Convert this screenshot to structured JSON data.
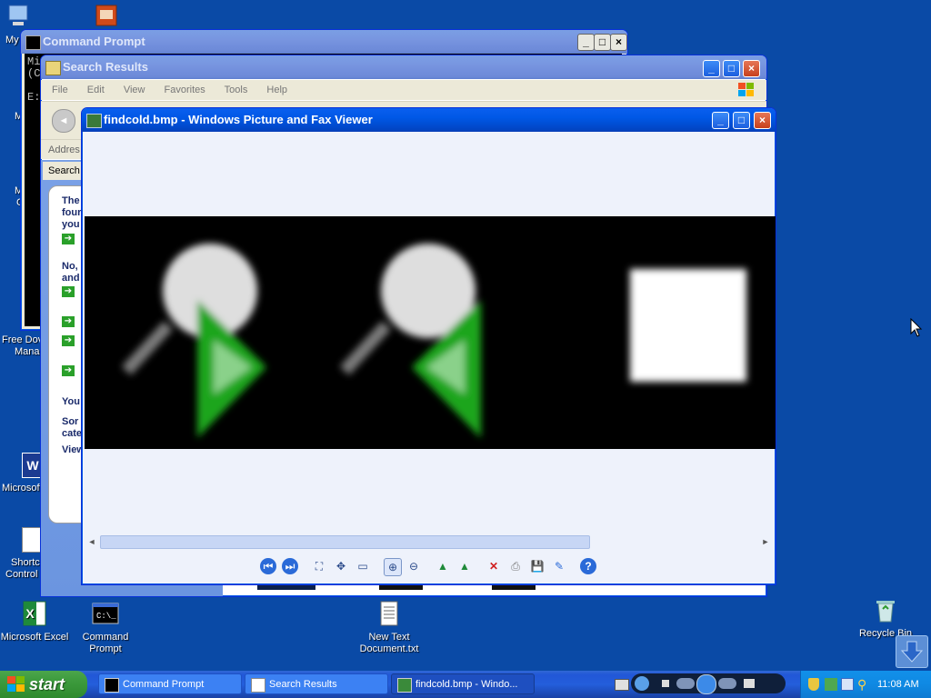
{
  "desktop": {
    "icons": {
      "my_computer": "My",
      "free_download_manager_1": "Free Dov",
      "free_download_manager_2": "Mana",
      "microsoft_word": "Microsoft",
      "shortcut_1": "Shortc",
      "shortcut_2": "Control",
      "excel": "Microsoft Excel",
      "cmd_1": "Command",
      "cmd_2": "Prompt",
      "text_doc_1": "New Text",
      "text_doc_2": "Document.txt",
      "recycle": "Recycle Bin"
    },
    "partials": {
      "m1": "M",
      "m2": "M",
      "m3": "C"
    }
  },
  "cmd_window": {
    "title": "Command Prompt",
    "text_lines": [
      "Mi",
      "(C",
      "",
      "E:"
    ]
  },
  "search_window": {
    "title": "Search Results",
    "menu": [
      "File",
      "Edit",
      "View",
      "Favorites",
      "Tools",
      "Help"
    ],
    "address_label": "Addres",
    "search_label": "Search",
    "assistant_text": [
      "The",
      "four",
      "you",
      "No,",
      "and",
      "You",
      "Sor",
      "cate",
      "View"
    ]
  },
  "viewer_window": {
    "title": "findcold.bmp - Windows Picture and Fax Viewer"
  },
  "taskbar": {
    "start_label": "start",
    "tasks": [
      "Command Prompt",
      "Search Results",
      "findcold.bmp - Windo..."
    ],
    "clock": "11:08 AM"
  },
  "colors": {
    "desktop": "#0a4aa6",
    "title_active": "#0058e6",
    "viewer_bg": "#eef2fb",
    "image_bg": "#000000",
    "green_arrow": "#1fa51f"
  }
}
